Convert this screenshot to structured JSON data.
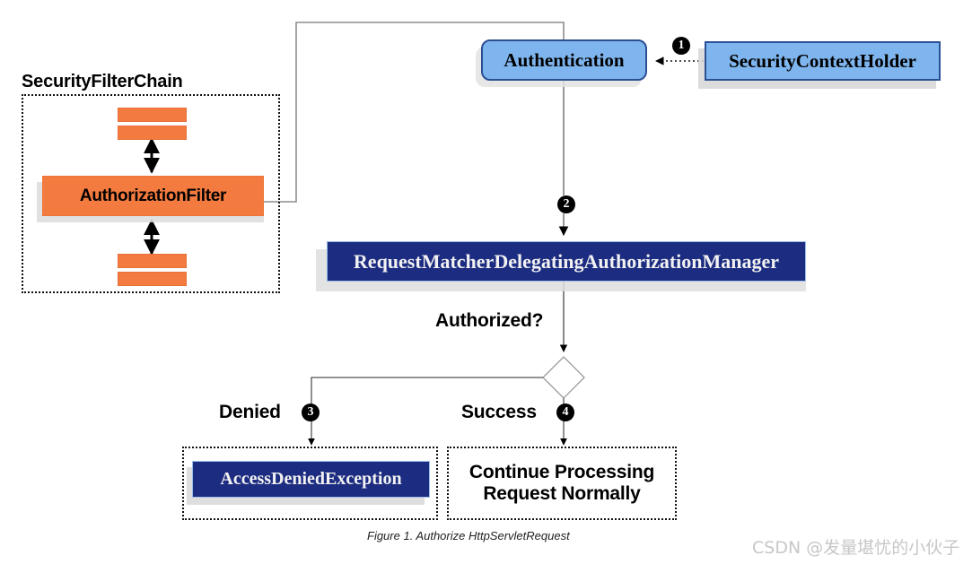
{
  "figure": {
    "caption": "Figure 1. Authorize HttpServletRequest",
    "watermark": "CSDN @发量堪忧的小伙子"
  },
  "colors": {
    "orange": "#F47B3F",
    "light_blue": "#7FB5EE",
    "navy": "#1C2C80",
    "blue_border": "#2B4F94",
    "shadow_gray": "#d9d9d9",
    "badge_black": "#000000",
    "watermark_gray": "#c7c7c7"
  },
  "filter_chain": {
    "title": "SecurityFilterChain",
    "main_filter": "AuthorizationFilter",
    "bars_top": [
      "filter-bar",
      "filter-bar"
    ],
    "bars_bottom": [
      "filter-bar",
      "filter-bar"
    ]
  },
  "nodes": {
    "authentication": "Authentication",
    "security_context_holder": "SecurityContextHolder",
    "authorization_manager": "RequestMatcherDelegatingAuthorizationManager",
    "access_denied_exception": "AccessDeniedException",
    "continue_processing": "Continue Processing\nRequest Normally",
    "continue_processing_line1": "Continue Processing",
    "continue_processing_line2": "Request Normally"
  },
  "decision": {
    "question": "Authorized?",
    "denied_label": "Denied",
    "success_label": "Success",
    "shape": "diamond"
  },
  "badges": {
    "one": "❶",
    "two": "❷",
    "three": "❸",
    "four": "❹",
    "one_num": "1",
    "two_num": "2",
    "three_num": "3",
    "four_num": "4"
  },
  "flow_steps": [
    {
      "number": "1",
      "from": "SecurityContextHolder",
      "to": "Authentication"
    },
    {
      "number": "2",
      "from": "Authentication",
      "to": "RequestMatcherDelegatingAuthorizationManager"
    },
    {
      "number": "3",
      "from": "Authorized? (Denied)",
      "to": "AccessDeniedException"
    },
    {
      "number": "4",
      "from": "Authorized? (Success)",
      "to": "Continue Processing Request Normally"
    }
  ]
}
